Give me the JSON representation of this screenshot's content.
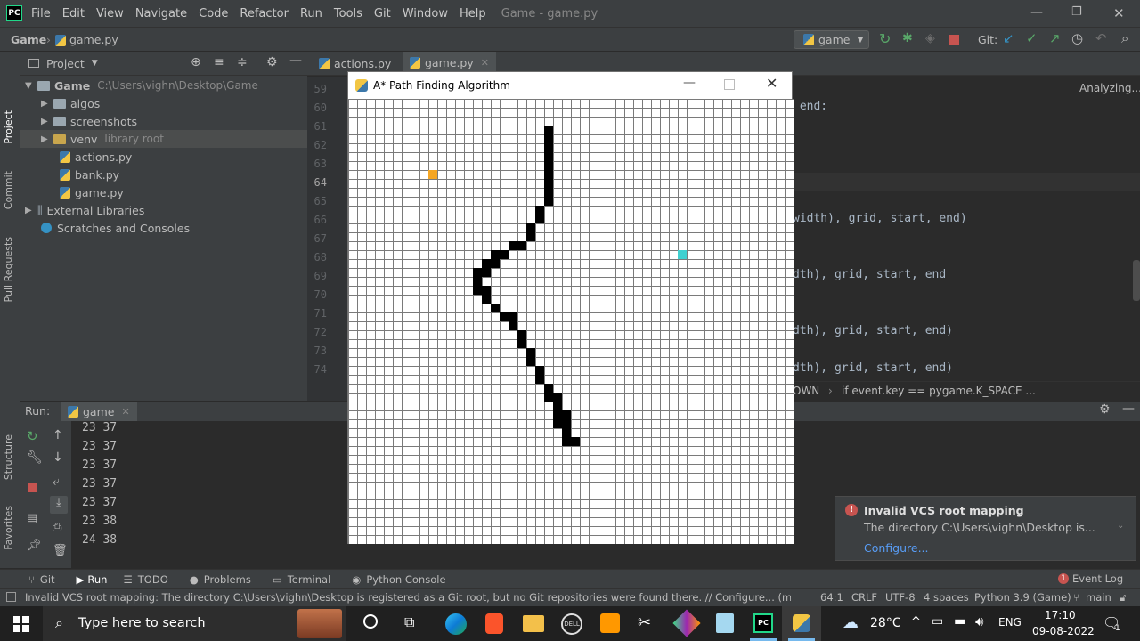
{
  "window": {
    "title": "Game - game.py"
  },
  "menu": [
    "File",
    "Edit",
    "View",
    "Navigate",
    "Code",
    "Refactor",
    "Run",
    "Tools",
    "Git",
    "Window",
    "Help"
  ],
  "nav": {
    "project": "Game",
    "file": "game.py",
    "run_config": "game",
    "git_label": "Git:"
  },
  "side_tabs": {
    "project": "Project",
    "commit": "Commit",
    "pull_requests": "Pull Requests",
    "structure": "Structure",
    "favorites": "Favorites"
  },
  "project_panel": {
    "title": "Project",
    "tree": [
      {
        "label": "Game",
        "hint": "C:\\Users\\vighn\\Desktop\\Game",
        "type": "root"
      },
      {
        "label": "algos",
        "hint": "",
        "type": "folder"
      },
      {
        "label": "screenshots",
        "hint": "",
        "type": "folder"
      },
      {
        "label": "venv",
        "hint": "library root",
        "type": "folder"
      },
      {
        "label": "actions.py",
        "hint": "",
        "type": "file"
      },
      {
        "label": "bank.py",
        "hint": "",
        "type": "file"
      },
      {
        "label": "game.py",
        "hint": "",
        "type": "file"
      },
      {
        "label": "External Libraries",
        "hint": "",
        "type": "lib"
      },
      {
        "label": "Scratches and Consoles",
        "hint": "",
        "type": "scratch"
      }
    ]
  },
  "editor_tabs": [
    "actions.py",
    "game.py"
  ],
  "editor": {
    "status": "Analyzing...",
    "line_numbers": [
      "59",
      "60",
      "61",
      "62",
      "63",
      "64",
      "65",
      "66",
      "67",
      "68",
      "69",
      "70",
      "71",
      "72",
      "73",
      "74"
    ],
    "visible_code": {
      "l60": " end:",
      "l66": "width), grid, start, end)",
      "l69": "dth), grid, start, end",
      "l72": "dth), grid, start, end)",
      "l74": "dth), grid, start, end)"
    },
    "breadcrumb": {
      "part1": "OWN",
      "part2": "if event.key == pygame.K_SPACE ..."
    }
  },
  "run_panel": {
    "label": "Run:",
    "tab": "game",
    "output": [
      "23  37",
      "23  37",
      "23  37",
      "23  37",
      "23  37",
      "23  38",
      "24  38"
    ]
  },
  "pygame_window": {
    "title": "A* Path Finding Algorithm",
    "grid_cells": 50,
    "start": {
      "col": 9,
      "row": 8,
      "color": "#f5a623"
    },
    "end": {
      "col": 37,
      "row": 17,
      "color": "#40d0d0"
    },
    "barrier_color": "#000000",
    "barriers": [
      [
        22,
        3
      ],
      [
        22,
        4
      ],
      [
        22,
        5
      ],
      [
        22,
        6
      ],
      [
        22,
        7
      ],
      [
        22,
        8
      ],
      [
        22,
        9
      ],
      [
        22,
        10
      ],
      [
        22,
        11
      ],
      [
        21,
        12
      ],
      [
        21,
        13
      ],
      [
        20,
        14
      ],
      [
        20,
        15
      ],
      [
        19,
        16
      ],
      [
        18,
        16
      ],
      [
        17,
        17
      ],
      [
        16,
        17
      ],
      [
        16,
        18
      ],
      [
        15,
        18
      ],
      [
        15,
        19
      ],
      [
        14,
        19
      ],
      [
        14,
        20
      ],
      [
        14,
        21
      ],
      [
        15,
        21
      ],
      [
        15,
        22
      ],
      [
        16,
        23
      ],
      [
        17,
        24
      ],
      [
        18,
        24
      ],
      [
        18,
        25
      ],
      [
        19,
        26
      ],
      [
        19,
        27
      ],
      [
        20,
        28
      ],
      [
        20,
        29
      ],
      [
        21,
        30
      ],
      [
        21,
        31
      ],
      [
        22,
        32
      ],
      [
        22,
        33
      ],
      [
        23,
        33
      ],
      [
        23,
        34
      ],
      [
        23,
        35
      ],
      [
        24,
        35
      ],
      [
        24,
        36
      ],
      [
        23,
        36
      ],
      [
        24,
        37
      ],
      [
        25,
        38
      ],
      [
        24,
        38
      ]
    ]
  },
  "notification": {
    "title": "Invalid VCS root mapping",
    "body": "The directory C:\\Users\\vighn\\Desktop is...",
    "action": "Configure..."
  },
  "bottom_tabs": [
    "Git",
    "Run",
    "TODO",
    "Problems",
    "Terminal",
    "Python Console"
  ],
  "event_log": "Event Log",
  "status": {
    "message": "Invalid VCS root mapping: The directory C:\\Users\\vighn\\Desktop is registered as a Git root, but no Git repositories were found there. // Configure... (moments ago)",
    "position": "64:1",
    "line_sep": "CRLF",
    "encoding": "UTF-8",
    "indent": "4 spaces",
    "interpreter": "Python 3.9 (Game)",
    "branch": "main"
  },
  "taskbar": {
    "search_placeholder": "Type here to search",
    "temperature": "28°C",
    "language": "ENG",
    "time": "17:10",
    "date": "09-08-2022",
    "notif_count": "1"
  }
}
